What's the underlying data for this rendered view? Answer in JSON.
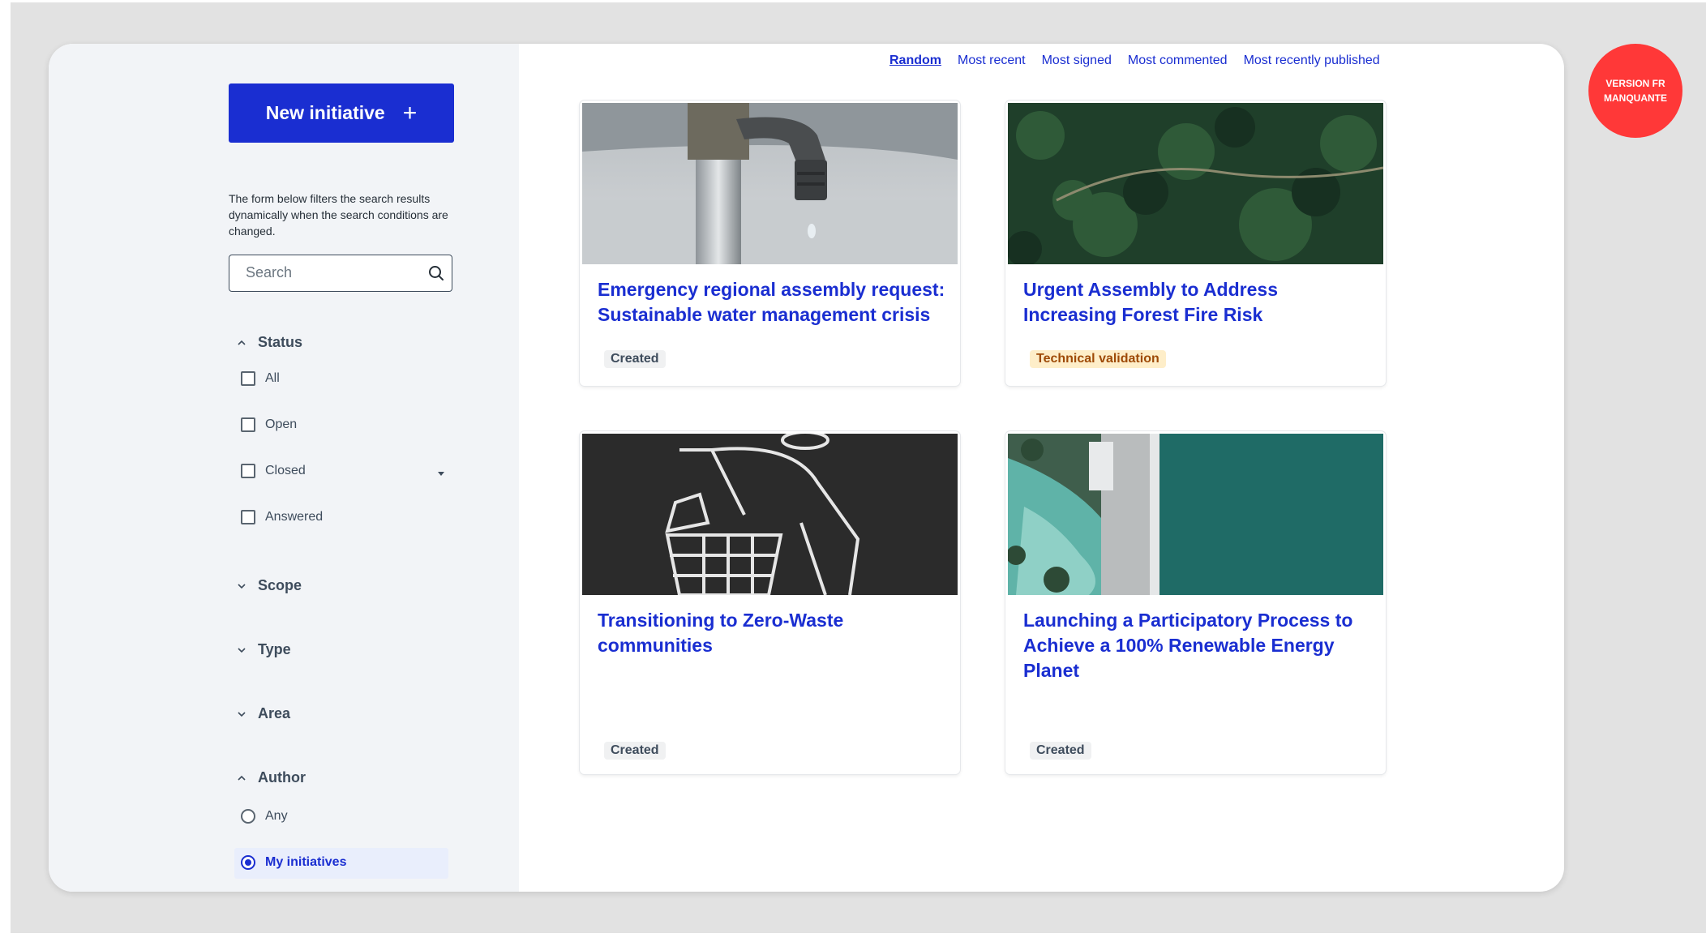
{
  "sidebar": {
    "new_initiative_label": "New initiative",
    "hint": "The form below filters the search results dynamically when the search conditions are changed.",
    "search_placeholder": "Search",
    "filters": {
      "status": {
        "label": "Status",
        "options": [
          "All",
          "Open",
          "Closed",
          "Answered"
        ]
      },
      "scope": {
        "label": "Scope"
      },
      "type": {
        "label": "Type"
      },
      "area": {
        "label": "Area"
      },
      "author": {
        "label": "Author",
        "options": [
          "Any",
          "My initiatives"
        ],
        "selected": "My initiatives"
      }
    }
  },
  "sort": {
    "options": [
      "Random",
      "Most recent",
      "Most signed",
      "Most commented",
      "Most recently published"
    ],
    "active": "Random"
  },
  "cards": [
    {
      "title": "Emergency regional assembly request: Sustainable water management crisis",
      "status": "Created"
    },
    {
      "title": "Urgent Assembly to Address Increasing Forest Fire Risk",
      "status": "Technical validation"
    },
    {
      "title": "Transitioning to Zero-Waste communities",
      "status": "Created"
    },
    {
      "title": "Launching a Participatory Process to Achieve a 100% Renewable Energy Planet",
      "status": "Created"
    }
  ],
  "corner_badge": "VERSION FR MANQUANTE",
  "colors": {
    "accent": "#1a2ed1",
    "sidebar_bg": "#f2f4f7",
    "warning_badge_bg": "#feeec9",
    "warning_badge_text": "#9e4a07",
    "corner_badge_bg": "#ff3838"
  }
}
